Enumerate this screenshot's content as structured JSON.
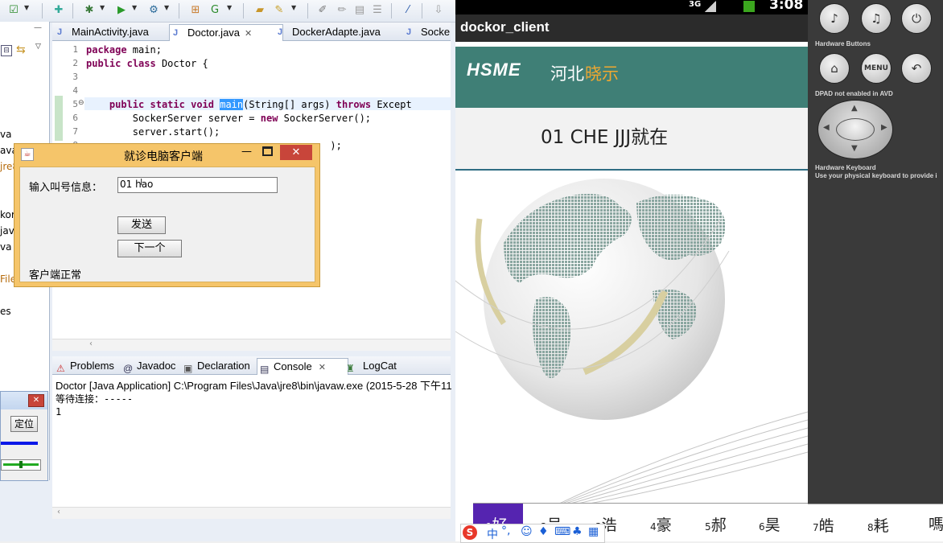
{
  "eclipse": {
    "editor_tabs": [
      {
        "label": "MainActivity.java",
        "active": false
      },
      {
        "label": "Doctor.java",
        "active": true
      },
      {
        "label": "DockerAdapte.java",
        "active": false
      },
      {
        "label": "Socke",
        "active": false
      }
    ],
    "code_lines": [
      {
        "no": "1",
        "text": "package main;"
      },
      {
        "no": "2",
        "text": "public class Doctor {"
      },
      {
        "no": "3",
        "text": ""
      },
      {
        "no": "4",
        "text": ""
      },
      {
        "no": "5",
        "text": "    public static void main(String[] args) throws Except"
      },
      {
        "no": "6",
        "text": "        SockerServer server = new SockerServer();"
      },
      {
        "no": "7",
        "text": "        server.start();"
      },
      {
        "no": "8",
        "text": "                                          );"
      }
    ],
    "left_panel_fragments": [
      "va",
      "ava",
      "jre8",
      "kor",
      "java",
      "va",
      "File",
      "es"
    ],
    "console_tabs": [
      {
        "label": "Problems",
        "icon": "problems-icon",
        "active": false
      },
      {
        "label": "Javadoc",
        "icon": "at-icon",
        "active": false
      },
      {
        "label": "Declaration",
        "icon": "declaration-icon",
        "active": false
      },
      {
        "label": "Console",
        "icon": "console-icon",
        "active": true
      },
      {
        "label": "LogCat",
        "icon": "logcat-icon",
        "active": false
      }
    ],
    "console_header": "Doctor [Java Application] C:\\Program Files\\Java\\jre8\\bin\\javaw.exe (2015-5-28 下午11",
    "console_lines": [
      "等待连接：-----",
      "1"
    ],
    "mini_window": {
      "button_label": "定位"
    }
  },
  "dialog": {
    "title": "就诊电脑客户端",
    "field_label": "输入叫号信息：",
    "field_value": "01 hao",
    "send_button": "发送",
    "next_button": "下一个",
    "status_text": "客户端正常"
  },
  "android": {
    "status": {
      "network": "3G",
      "time": "3:08"
    },
    "app_title": "dockor_client",
    "banner_logo": "HSME",
    "banner_text_a": "河北",
    "banner_text_b": "晓示",
    "headline": "01 CHE JJJ就在",
    "candidates": [
      {
        "num": "1",
        "ch": "好"
      },
      {
        "num": "2",
        "ch": "号"
      },
      {
        "num": "3",
        "ch": "浩"
      },
      {
        "num": "4",
        "ch": "豪"
      },
      {
        "num": "5",
        "ch": "郝"
      },
      {
        "num": "6",
        "ch": "昊"
      },
      {
        "num": "7",
        "ch": "皓"
      },
      {
        "num": "8",
        "ch": "耗"
      }
    ],
    "ime_bar_text": "中",
    "colors": {
      "banner": "#3f7f76",
      "accent_orange": "#f0a830",
      "candidate_selected": "#5524b0"
    }
  },
  "avd": {
    "hardware_buttons_label": "Hardware Buttons",
    "dpad_label": "DPAD not enabled in AVD",
    "keyboard_label": "Hardware Keyboard",
    "keyboard_hint": "Use your physical keyboard to provide i",
    "menu_label": "MENU"
  }
}
